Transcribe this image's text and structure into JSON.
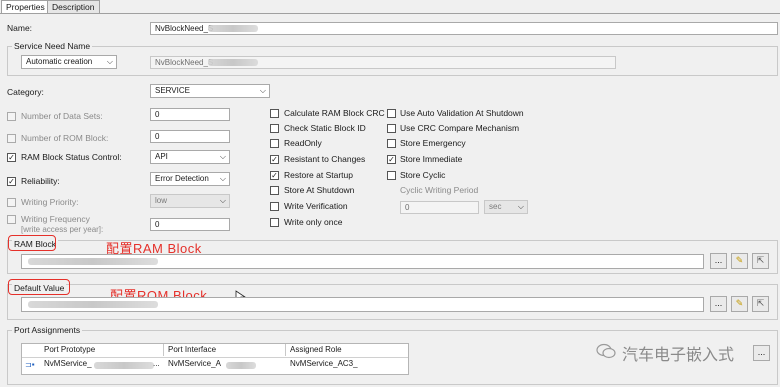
{
  "tabs": [
    {
      "label": "Properties"
    },
    {
      "label": "Description"
    }
  ],
  "name": {
    "label": "Name:",
    "value": "NvBlockNeed_S"
  },
  "service_need_name": {
    "title": "Service Need Name",
    "mode": "Automatic creation",
    "value": "NvBlockNeed_S"
  },
  "category": {
    "label": "Category:",
    "value": "SERVICE"
  },
  "left_fields": {
    "data_sets": {
      "label": "Number of Data Sets:",
      "value": "0"
    },
    "rom_block": {
      "label": "Number of ROM Block:",
      "value": "0"
    },
    "ram_status": {
      "label": "RAM Block Status Control:",
      "value": "API"
    },
    "reliability": {
      "label": "Reliability:",
      "value": "Error Detection"
    },
    "writing_priority": {
      "label": "Writing Priority:",
      "value": "low"
    },
    "writing_frequency": {
      "label": "Writing Frequency",
      "sublabel": "[write access per year]:",
      "value": "0"
    }
  },
  "middle_checks": [
    {
      "label": "Calculate RAM Block CRC",
      "checked": false
    },
    {
      "label": "Check Static Block ID",
      "checked": false
    },
    {
      "label": "ReadOnly",
      "checked": false
    },
    {
      "label": "Resistant to Changes",
      "checked": true
    },
    {
      "label": "Restore at Startup",
      "checked": true
    },
    {
      "label": "Store At Shutdown",
      "checked": false
    },
    {
      "label": "Write Verification",
      "checked": false
    },
    {
      "label": "Write only once",
      "checked": false
    }
  ],
  "right_checks": [
    {
      "label": "Use Auto Validation At Shutdown",
      "checked": false
    },
    {
      "label": "Use CRC Compare Mechanism",
      "checked": false
    },
    {
      "label": "Store Emergency",
      "checked": false
    },
    {
      "label": "Store Immediate",
      "checked": true
    },
    {
      "label": "Store Cyclic",
      "checked": false
    }
  ],
  "cyclic": {
    "label": "Cyclic Writing Period",
    "value": "0",
    "unit": "sec"
  },
  "ram_block": {
    "label": "RAM Block",
    "annotation": "配置RAM   Block"
  },
  "default_value": {
    "label": "Default Value",
    "annotation": "配置ROM   Block"
  },
  "buttons": {
    "browse": "...",
    "new": "✎",
    "open": "⇱"
  },
  "ports": {
    "title": "Port Assignments",
    "headers": [
      "Port Prototype",
      "Port Interface",
      "Assigned Role"
    ],
    "rows": [
      {
        "prototype": "NvMService_",
        "interface": "NvMService_A",
        "role": "NvMService_AC3_"
      }
    ],
    "ellipsis": "..."
  },
  "watermark": "汽车电子嵌入式",
  "colors": {
    "annotation": "#e5302a",
    "accent": "#1f5fbf"
  }
}
